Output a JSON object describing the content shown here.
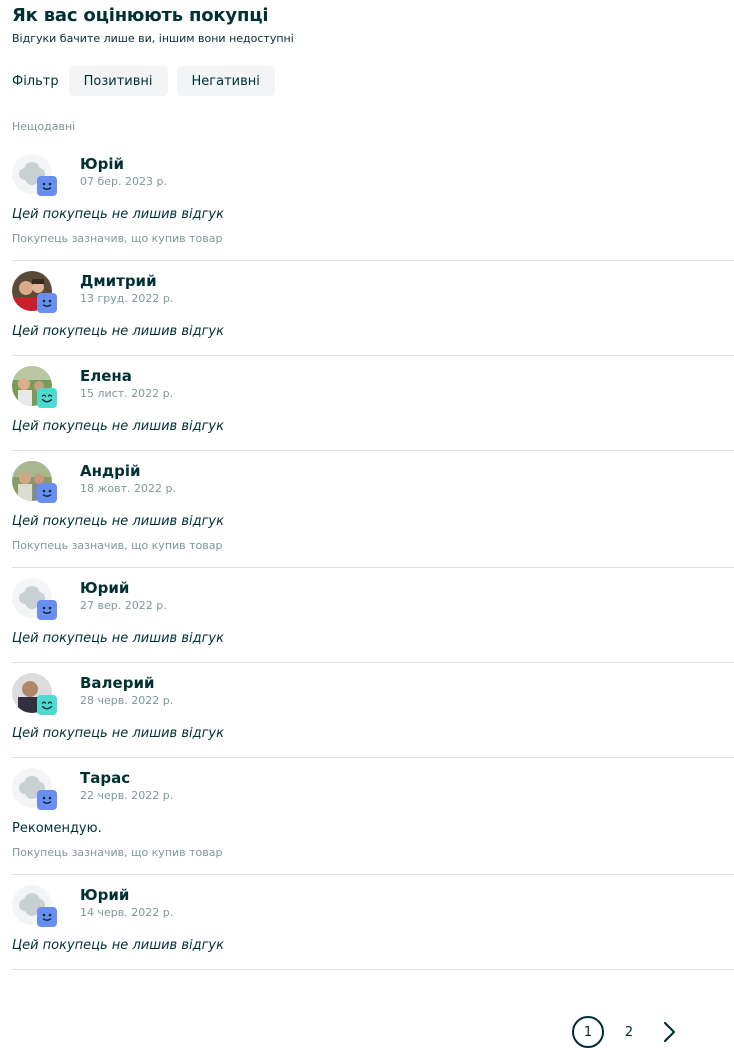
{
  "header": {
    "title": "Як вас оцінюють покупці",
    "subtitle": "Відгуки бачите лише ви, іншим вони недоступні"
  },
  "filter": {
    "label": "Фільтр",
    "positive_label": "Позитивні",
    "negative_label": "Негативні"
  },
  "section_label": "Нещодавні",
  "reviews": [
    {
      "name": "Юрій",
      "date": "07 бер. 2023 р.",
      "text": "Цей покупець не лишив відгук",
      "note": "Покупець зазначив, що купив товар",
      "avatar": "placeholder",
      "badge": "neutral-face-icon"
    },
    {
      "name": "Дмитрий",
      "date": "13 груд. 2022 р.",
      "text": "Цей покупець не лишив відгук",
      "note": "",
      "avatar": "photo",
      "badge": "neutral-face-icon"
    },
    {
      "name": "Елена",
      "date": "15 лист. 2022 р.",
      "text": "Цей покупець не лишив відгук",
      "note": "",
      "avatar": "photo",
      "badge": "happy-face-icon"
    },
    {
      "name": "Андрій",
      "date": "18 жовт. 2022 р.",
      "text": "Цей покупець не лишив відгук",
      "note": "Покупець зазначив, що купив товар",
      "avatar": "photo",
      "badge": "neutral-face-icon"
    },
    {
      "name": "Юрий",
      "date": "27 вер. 2022 р.",
      "text": "Цей покупець не лишив відгук",
      "note": "",
      "avatar": "placeholder",
      "badge": "neutral-face-icon"
    },
    {
      "name": "Валерий",
      "date": "28 черв. 2022 р.",
      "text": "Цей покупець не лишив відгук",
      "note": "",
      "avatar": "photo",
      "badge": "happy-face-icon"
    },
    {
      "name": "Тарас",
      "date": "22 черв. 2022 р.",
      "text": "Рекомендую.",
      "note": "Покупець зазначив, що купив товар",
      "avatar": "placeholder",
      "badge": "neutral-face-icon"
    },
    {
      "name": "Юрий",
      "date": "14 черв. 2022 р.",
      "text": "Цей покупець не лишив відгук",
      "note": "",
      "avatar": "placeholder",
      "badge": "neutral-face-icon"
    }
  ],
  "pagination": {
    "pages": [
      "1",
      "2"
    ],
    "current": "1"
  },
  "colors": {
    "text": "#002f34",
    "muted": "#7f9799",
    "divider": "#d8dfe0",
    "badge_neutral": "#6a8ef0",
    "badge_happy": "#4fd9d0",
    "filter_bg": "#f2f4f5"
  }
}
